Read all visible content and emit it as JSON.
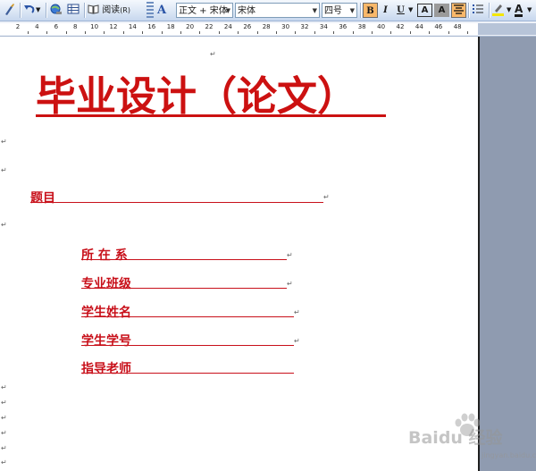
{
  "toolbar": {
    "read_label": "阅读",
    "read_shortcut": "(R)",
    "style_value": "正文 + 宋体",
    "font_value": "宋体",
    "size_value": "四号",
    "bold_label": "B",
    "italic_label": "I",
    "underline_label": "U",
    "charborder_label": "A",
    "charshade_label": "A",
    "fontcolor_label": "A",
    "style_icon_label": "A"
  },
  "ruler": {
    "labels": [
      "2",
      "4",
      "6",
      "8",
      "10",
      "12",
      "14",
      "16",
      "18",
      "20",
      "22",
      "24",
      "26",
      "28",
      "30",
      "32",
      "34",
      "36",
      "38",
      "40",
      "42",
      "44",
      "46",
      "48"
    ]
  },
  "document": {
    "title": "毕业设计（论文）",
    "topic_label": "题目",
    "fields": [
      "所 在 系",
      "专业班级",
      "学生姓名",
      "学生学号",
      "指导老师"
    ]
  },
  "watermark": {
    "text": "Baidu 经验",
    "sub": "jingyan.baidu.com"
  },
  "colors": {
    "accent_red": "#c8101a",
    "toolbar_bg": "#dce7f5",
    "margin_bg": "#8f9bb0"
  }
}
